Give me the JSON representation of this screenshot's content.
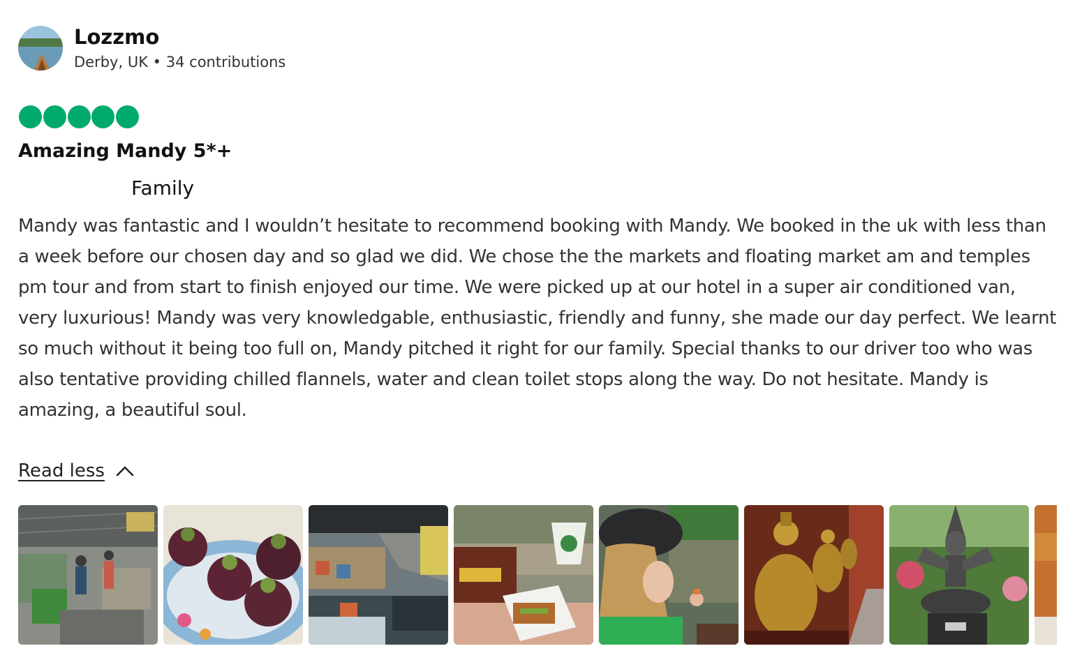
{
  "reviewer": {
    "name": "Lozzmo",
    "location": "Derby, UK",
    "separator": "•",
    "contributions": "34 contributions"
  },
  "rating": {
    "value": 5,
    "max": 5,
    "bubble_color": "#00aa6c"
  },
  "review": {
    "title": "Amazing Mandy 5*+",
    "trip_type": "Family",
    "body": "Mandy was fantastic and I wouldn’t hesitate to recommend booking with Mandy. We booked in the uk with less than a week before our chosen day and so glad we did. We chose the the markets and floating market am and temples pm tour and from start to finish enjoyed our time. We were picked up at our hotel in a super air conditioned van, very luxurious! Mandy was very knowledgable, enthusiastic, friendly and funny, she made our day perfect. We learnt so much without it being too full on, Mandy pitched it right for our family. Special thanks to our driver too who was also tentative providing chilled flannels, water and clean toilet stops along the way. Do not hesitate. Mandy is amazing, a beautiful soul.",
    "toggle_label": "Read less",
    "toggle_icon": "chevron-up-icon"
  },
  "photos": [
    {
      "name": "photo-market"
    },
    {
      "name": "photo-mangosteens"
    },
    {
      "name": "photo-floating-market"
    },
    {
      "name": "photo-boat-snack"
    },
    {
      "name": "photo-girl-canal"
    },
    {
      "name": "photo-golden-buddhas"
    },
    {
      "name": "photo-statue"
    },
    {
      "name": "photo-partial"
    }
  ]
}
